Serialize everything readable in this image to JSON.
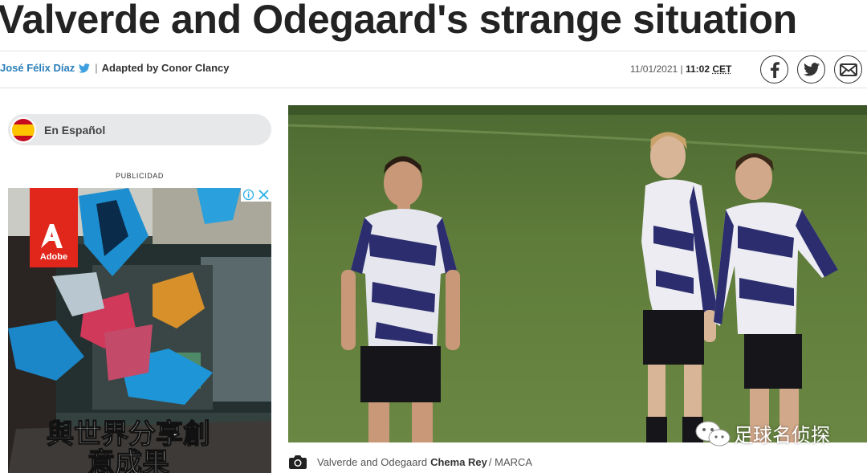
{
  "article": {
    "headline": "Valverde and Odegaard's strange situation",
    "author": "José Félix Díaz",
    "byline_separator": "|",
    "adapted_by": "Adapted by Conor Clancy",
    "date": "11/01/2021",
    "date_separator": "|",
    "time": "11:02",
    "timezone": "CET"
  },
  "share": {
    "facebook_icon": "facebook-icon",
    "twitter_icon": "twitter-icon",
    "email_icon": "email-icon"
  },
  "language_switch": {
    "label": "En Español",
    "flag_icon": "spain-flag-icon"
  },
  "ad": {
    "label": "PUBLICIDAD",
    "brand_logo_text": "Adobe",
    "headline_line1": "與世界分享創",
    "headline_line2": "意成果",
    "info_icon": "info-icon",
    "close_icon": "close-icon"
  },
  "photo": {
    "caption": "Valverde and Odegaard",
    "credit": "Chema Rey",
    "source": "/ MARCA",
    "camera_icon": "camera-icon"
  },
  "watermark": {
    "text": "足球名侦探",
    "icon": "wechat-icon"
  },
  "colors": {
    "author_link": "#2a7fba",
    "adobe_red": "#e1261c",
    "pitch_green": "#5f7c3a"
  }
}
